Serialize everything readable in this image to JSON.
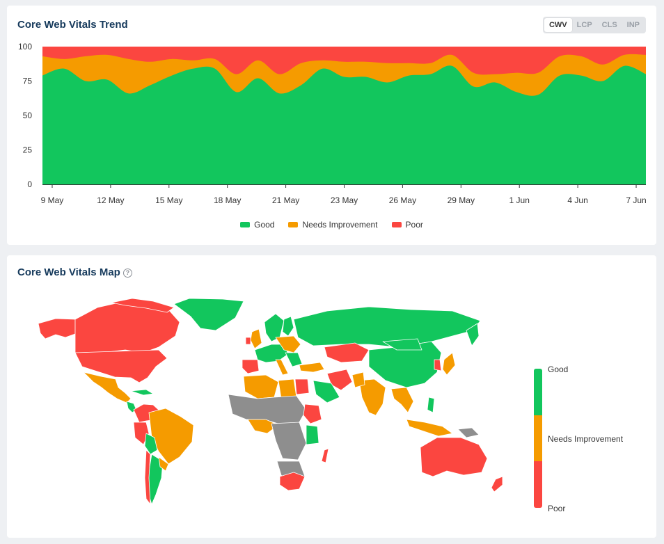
{
  "colors": {
    "good": "#12c65d",
    "needs": "#f59b00",
    "poor": "#fb4640",
    "nodata": "#8e8e8e"
  },
  "trend": {
    "title": "Core Web Vitals Trend",
    "tabs": [
      "CWV",
      "LCP",
      "CLS",
      "INP"
    ],
    "active_tab": "CWV"
  },
  "chart_data": {
    "type": "area",
    "stacked": true,
    "title": "Core Web Vitals Trend",
    "x_tick_labels": [
      "9 May",
      "12 May",
      "15 May",
      "18 May",
      "21 May",
      "23 May",
      "26 May",
      "29 May",
      "1 Jun",
      "4 Jun",
      "7 Jun"
    ],
    "x_tick_index": [
      0.5,
      3.5,
      6.5,
      9.5,
      12.5,
      15.5,
      18.5,
      21.5,
      24.5,
      27.5,
      30.5
    ],
    "yticks": [
      0,
      25,
      50,
      75,
      100
    ],
    "ylim": [
      0,
      100
    ],
    "legend_position": "bottom",
    "series": [
      {
        "name": "Good",
        "values": [
          79,
          84,
          75,
          76,
          66,
          72,
          79,
          84,
          84,
          67,
          77,
          66,
          72,
          84,
          78,
          78,
          74,
          79,
          80,
          86,
          71,
          74,
          67,
          65,
          79,
          79,
          75,
          86,
          80
        ]
      },
      {
        "name": "Needs Improvement",
        "values": [
          14,
          7,
          18,
          18,
          25,
          17,
          12,
          6,
          7,
          13,
          13,
          14,
          16,
          6,
          11,
          11,
          14,
          9,
          8,
          8,
          10,
          6,
          14,
          16,
          14,
          14,
          12,
          8,
          14
        ]
      },
      {
        "name": "Poor",
        "values": [
          7,
          9,
          7,
          6,
          9,
          11,
          9,
          10,
          9,
          20,
          10,
          20,
          12,
          10,
          11,
          11,
          12,
          12,
          12,
          6,
          19,
          20,
          19,
          19,
          7,
          7,
          13,
          6,
          6
        ]
      }
    ],
    "legend": [
      "Good",
      "Needs Improvement",
      "Poor"
    ]
  },
  "map": {
    "title": "Core Web Vitals Map",
    "help_icon": "question-circle-icon",
    "help_glyph": "?",
    "scale_labels": [
      "Good",
      "Needs Improvement",
      "Poor"
    ]
  }
}
